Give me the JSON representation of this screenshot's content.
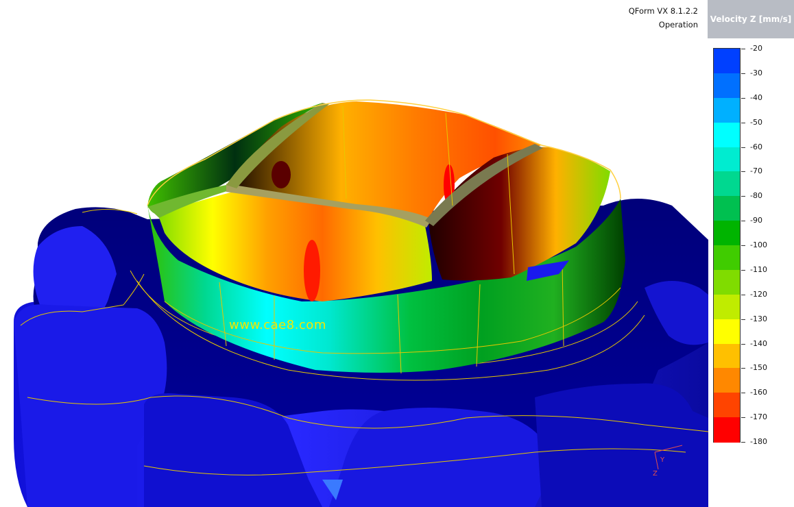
{
  "app": {
    "title": "QForm VX 8.1.2.2",
    "subtitle": "Operation"
  },
  "legend": {
    "title": "Velocity Z  [mm/s]",
    "labels": [
      "-20",
      "-30",
      "-40",
      "-50",
      "-60",
      "-70",
      "-80",
      "-90",
      "-100",
      "-110",
      "-120",
      "-130",
      "-140",
      "-150",
      "-160",
      "-170",
      "-180"
    ],
    "colors": [
      "#0040ff",
      "#0070ff",
      "#00b0ff",
      "#00ffff",
      "#00ecd0",
      "#00d890",
      "#00c050",
      "#00b400",
      "#40cc00",
      "#80dc00",
      "#c0ec00",
      "#ffff00",
      "#ffc000",
      "#ff8800",
      "#ff4400",
      "#ff0000"
    ]
  },
  "watermark": "www.cae8.com",
  "axis_labels": {
    "y": "Y",
    "z": "Z"
  }
}
